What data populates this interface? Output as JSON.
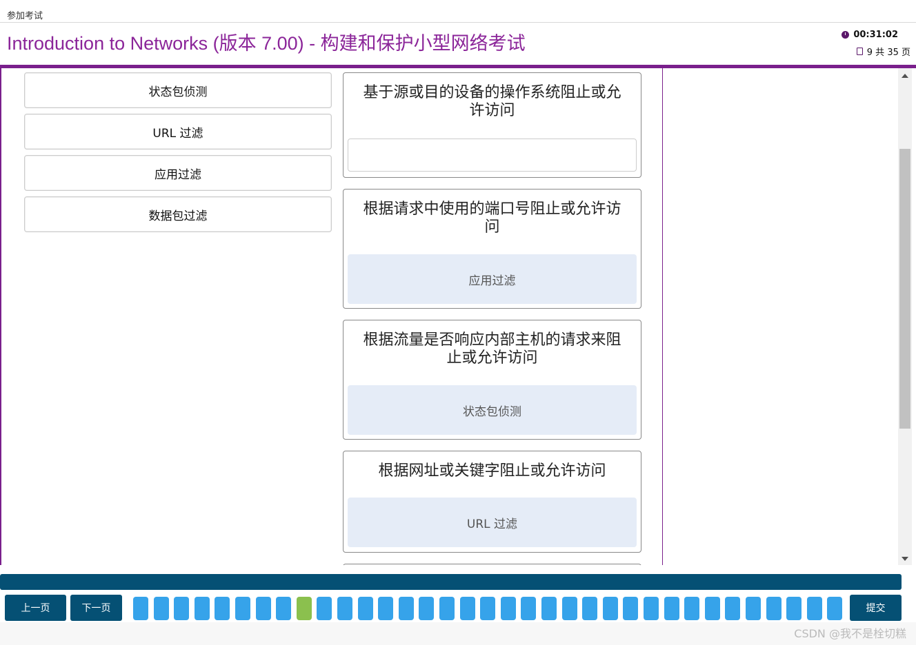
{
  "breadcrumb": "参加考试",
  "header": {
    "title": "Introduction to Networks (版本 7.00) - 构建和保护小型网络考试",
    "timer": "00:31:02",
    "page_info": "9 共 35 页"
  },
  "sources": [
    {
      "label": "状态包侦测"
    },
    {
      "label": "URL 过滤"
    },
    {
      "label": "应用过滤"
    },
    {
      "label": "数据包过滤"
    }
  ],
  "targets": [
    {
      "prompt": "基于源或目的设备的操作系统阻止或允许访问",
      "answer": ""
    },
    {
      "prompt": "根据请求中使用的端口号阻止或允许访问",
      "answer": "应用过滤"
    },
    {
      "prompt": "根据流量是否响应内部主机的请求来阻止或允许访问",
      "answer": "状态包侦测"
    },
    {
      "prompt": "根据网址或关键字阻止或允许访问",
      "answer": "URL 过滤"
    }
  ],
  "nav": {
    "prev_label": "上一页",
    "next_label": "下一页",
    "submit_label": "提交",
    "question_count": 35,
    "current_index": 9
  },
  "watermark": "CSDN @我不是栓切糕",
  "colors": {
    "brand_purple": "#8b2599",
    "nav_blue": "#055074",
    "question_box": "#36a3ea",
    "current_box": "#8bc04e",
    "answer_bg": "#e5ecf7"
  },
  "icons": [
    "clock-icon",
    "page-icon",
    "scroll-up-icon",
    "scroll-down-icon"
  ]
}
